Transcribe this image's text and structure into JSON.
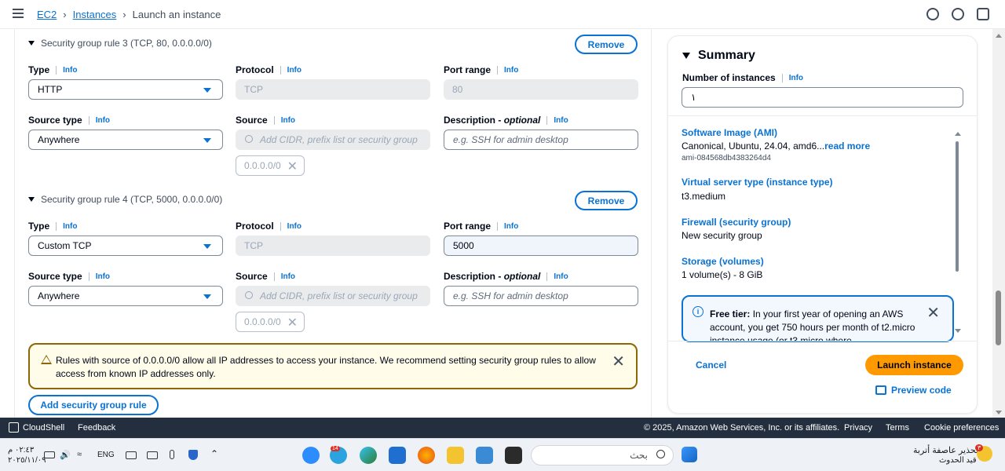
{
  "breadcrumb": {
    "ec2": "EC2",
    "instances": "Instances",
    "current": "Launch an instance"
  },
  "rules": [
    {
      "title": "Security group rule 3 (TCP, 80, 0.0.0.0/0)",
      "remove_label": "Remove",
      "type_label": "Type",
      "type_value": "HTTP",
      "protocol_label": "Protocol",
      "protocol_value": "TCP",
      "port_label": "Port range",
      "port_value": "80",
      "source_type_label": "Source type",
      "source_type_value": "Anywhere",
      "source_label": "Source",
      "source_placeholder": "Add CIDR, prefix list or security group",
      "source_token": "0.0.0.0/0",
      "desc_label": "Description - ",
      "desc_optional": "optional",
      "desc_placeholder": "e.g. SSH for admin desktop"
    },
    {
      "title": "Security group rule 4 (TCP, 5000, 0.0.0.0/0)",
      "remove_label": "Remove",
      "type_label": "Type",
      "type_value": "Custom TCP",
      "protocol_label": "Protocol",
      "protocol_value": "TCP",
      "port_label": "Port range",
      "port_value": "5000",
      "source_type_label": "Source type",
      "source_type_value": "Anywhere",
      "source_label": "Source",
      "source_placeholder": "Add CIDR, prefix list or security group",
      "source_token": "0.0.0.0/0",
      "desc_label": "Description - ",
      "desc_optional": "optional",
      "desc_placeholder": "e.g. SSH for admin desktop"
    }
  ],
  "info_label": "Info",
  "warning": {
    "text": "Rules with source of 0.0.0.0/0 allow all IP addresses to access your instance. We recommend setting security group rules to allow access from known IP addresses only."
  },
  "add_rule_label": "Add security group rule",
  "summary": {
    "title": "Summary",
    "num_instances_label": "Number of instances",
    "num_instances_value": "١",
    "ami_title": "Software Image (AMI)",
    "ami_value": "Canonical, Ubuntu, 24.04, amd6...",
    "ami_read_more": "read more",
    "ami_id": "ami-084568db4383264d4",
    "instance_type_title": "Virtual server type (instance type)",
    "instance_type_value": "t3.medium",
    "firewall_title": "Firewall (security group)",
    "firewall_value": "New security group",
    "storage_title": "Storage (volumes)",
    "storage_value": "1 volume(s) - 8 GiB",
    "free_tier_bold": "Free tier:",
    "free_tier_text": " In your first year of opening an AWS account, you get 750 hours per month of t2.micro instance usage (or t3.micro where",
    "cancel_label": "Cancel",
    "launch_label": "Launch instance",
    "preview_label": "Preview code"
  },
  "footer": {
    "cloudshell": "CloudShell",
    "feedback": "Feedback",
    "copyright": "© 2025, Amazon Web Services, Inc. or its affiliates.",
    "privacy": "Privacy",
    "terms": "Terms",
    "cookies": "Cookie preferences"
  },
  "taskbar": {
    "time": "٠٢:٤٣ م",
    "date": "٢٠٢٥/١١/٠٩",
    "lang": "ENG",
    "search_placeholder": "بحث",
    "notification_title": "تحذير عاصفة أتربة",
    "notification_sub": "قيد الحدوث",
    "telegram_badge": "14",
    "notification_badge": "٣"
  }
}
